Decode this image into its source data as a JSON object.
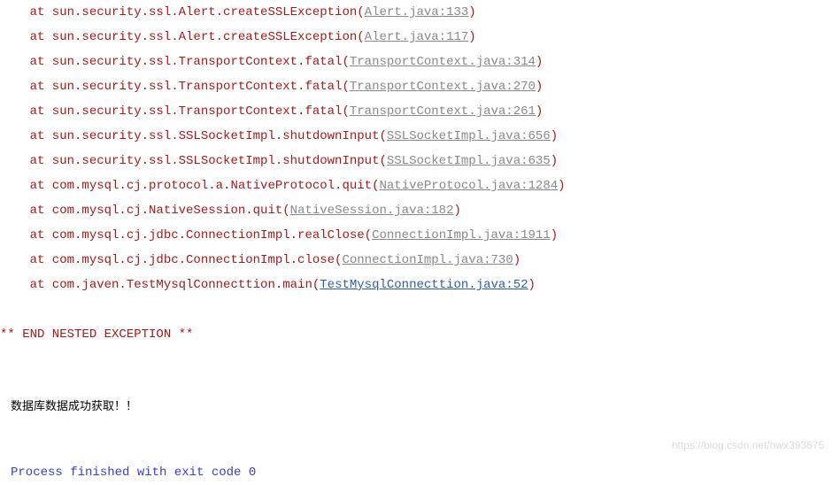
{
  "stack_trace": {
    "at_prefix": "    at ",
    "frames": [
      {
        "method": "sun.security.ssl.Alert.createSSLException",
        "file": "Alert.java",
        "line": 133,
        "own": false
      },
      {
        "method": "sun.security.ssl.Alert.createSSLException",
        "file": "Alert.java",
        "line": 117,
        "own": false
      },
      {
        "method": "sun.security.ssl.TransportContext.fatal",
        "file": "TransportContext.java",
        "line": 314,
        "own": false
      },
      {
        "method": "sun.security.ssl.TransportContext.fatal",
        "file": "TransportContext.java",
        "line": 270,
        "own": false
      },
      {
        "method": "sun.security.ssl.TransportContext.fatal",
        "file": "TransportContext.java",
        "line": 261,
        "own": false
      },
      {
        "method": "sun.security.ssl.SSLSocketImpl.shutdownInput",
        "file": "SSLSocketImpl.java",
        "line": 656,
        "own": false
      },
      {
        "method": "sun.security.ssl.SSLSocketImpl.shutdownInput",
        "file": "SSLSocketImpl.java",
        "line": 635,
        "own": false
      },
      {
        "method": "com.mysql.cj.protocol.a.NativeProtocol.quit",
        "file": "NativeProtocol.java",
        "line": 1284,
        "own": false
      },
      {
        "method": "com.mysql.cj.NativeSession.quit",
        "file": "NativeSession.java",
        "line": 182,
        "own": false
      },
      {
        "method": "com.mysql.cj.jdbc.ConnectionImpl.realClose",
        "file": "ConnectionImpl.java",
        "line": 1911,
        "own": false
      },
      {
        "method": "com.mysql.cj.jdbc.ConnectionImpl.close",
        "file": "ConnectionImpl.java",
        "line": 730,
        "own": false
      },
      {
        "method": "com.javen.TestMysqlConnecttion.main",
        "file": "TestMysqlConnecttion.java",
        "line": 52,
        "own": true
      }
    ]
  },
  "end_nested": "** END NESTED EXCEPTION **",
  "success_message": "数据库数据成功获取！！",
  "exit_line": "Process finished with exit code 0",
  "watermark": "https://blog.csdn.net/hwx393675"
}
